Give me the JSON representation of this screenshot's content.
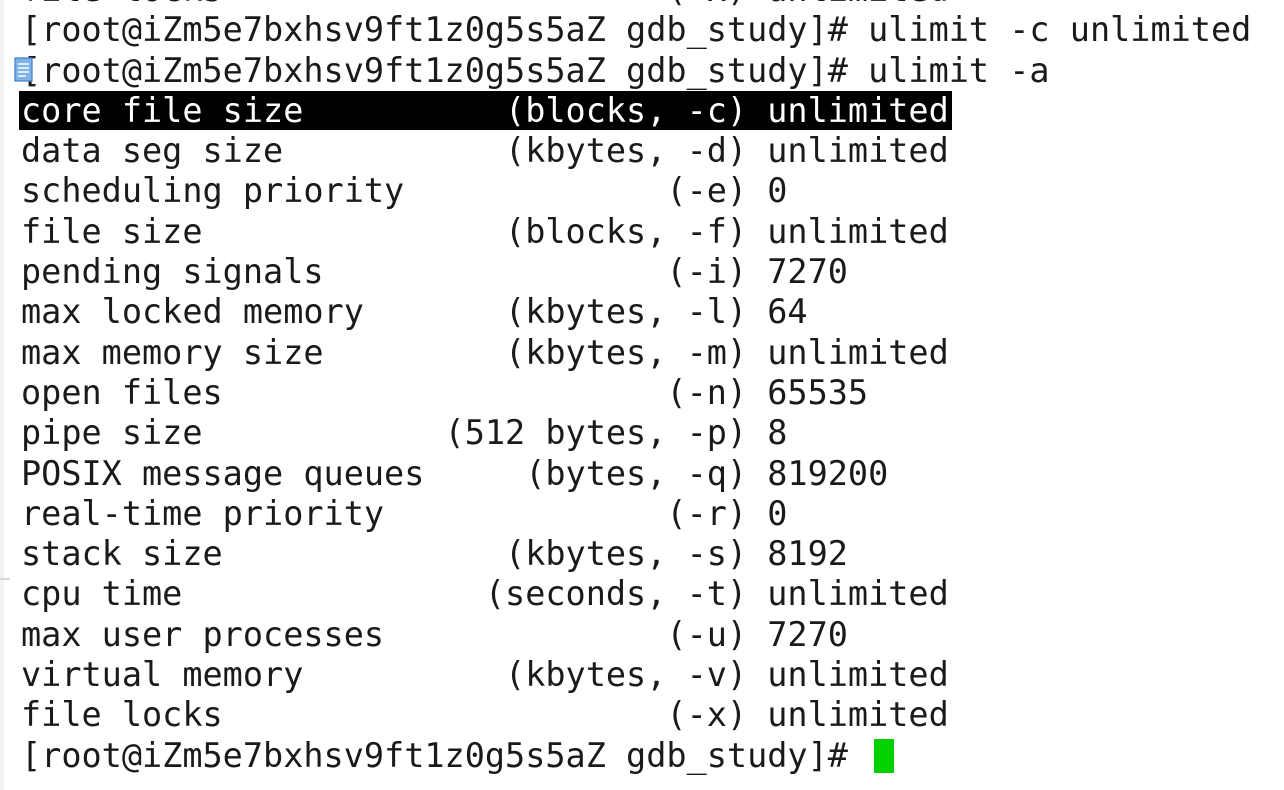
{
  "terminal": {
    "lines": [
      {
        "text": "file locks                      (-x) unlimited",
        "kind": "scrollback-partial"
      },
      {
        "text": "[root@iZm5e7bxhsv9ft1z0g5s5aZ gdb_study]# ulimit -c unlimited",
        "kind": "command"
      },
      {
        "text": "[root@iZm5e7bxhsv9ft1z0g5s5aZ gdb_study]# ulimit -a",
        "kind": "command"
      },
      {
        "text": "core file size          (blocks, -c) unlimited",
        "kind": "output-selected"
      },
      {
        "text": "data seg size           (kbytes, -d) unlimited",
        "kind": "output"
      },
      {
        "text": "scheduling priority             (-e) 0",
        "kind": "output"
      },
      {
        "text": "file size               (blocks, -f) unlimited",
        "kind": "output"
      },
      {
        "text": "pending signals                 (-i) 7270",
        "kind": "output"
      },
      {
        "text": "max locked memory       (kbytes, -l) 64",
        "kind": "output"
      },
      {
        "text": "max memory size         (kbytes, -m) unlimited",
        "kind": "output"
      },
      {
        "text": "open files                      (-n) 65535",
        "kind": "output"
      },
      {
        "text": "pipe size            (512 bytes, -p) 8",
        "kind": "output"
      },
      {
        "text": "POSIX message queues     (bytes, -q) 819200",
        "kind": "output"
      },
      {
        "text": "real-time priority              (-r) 0",
        "kind": "output"
      },
      {
        "text": "stack size              (kbytes, -s) 8192",
        "kind": "output"
      },
      {
        "text": "cpu time               (seconds, -t) unlimited",
        "kind": "output"
      },
      {
        "text": "max user processes              (-u) 7270",
        "kind": "output"
      },
      {
        "text": "virtual memory          (kbytes, -v) unlimited",
        "kind": "output"
      },
      {
        "text": "file locks                      (-x) unlimited",
        "kind": "output"
      }
    ],
    "prompt": "[root@iZm5e7bxhsv9ft1z0g5s5aZ gdb_study]# ",
    "cursor_color": "#00d100",
    "selection_color": "#000000",
    "background_color": "#ffffff",
    "icons": {
      "gutter": "document-icon"
    }
  }
}
